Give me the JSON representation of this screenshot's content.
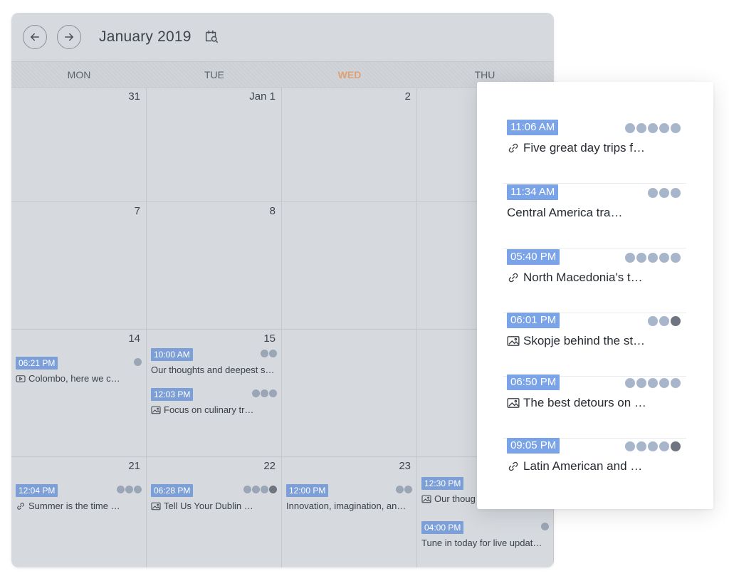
{
  "calendar": {
    "month_title": "January 2019",
    "weekdays": [
      "MON",
      "TUE",
      "WED",
      "THU"
    ],
    "today_weekday": "WED",
    "cells": [
      {
        "id": "r1c1",
        "day": "31",
        "events": []
      },
      {
        "id": "r1c2",
        "day": "Jan 1",
        "events": []
      },
      {
        "id": "r1c3",
        "day": "2",
        "events": []
      },
      {
        "id": "r2c1",
        "day": "7",
        "events": []
      },
      {
        "id": "r2c2",
        "day": "8",
        "events": []
      },
      {
        "id": "r3c1",
        "day": "14",
        "events": [
          {
            "time": "06:21 PM",
            "title": "Colombo, here we c…",
            "type": "video",
            "networks": [
              "twitter"
            ]
          }
        ]
      },
      {
        "id": "r3c2",
        "day": "15",
        "events": [
          {
            "time": "10:00 AM",
            "title": "Our thoughts and deepest s…",
            "type": "text",
            "networks": [
              "facebook",
              "twitter"
            ]
          },
          {
            "time": "12:03 PM",
            "title": "Focus on culinary tr…",
            "type": "image",
            "networks": [
              "facebook",
              "twitter",
              "linkedin"
            ]
          }
        ]
      },
      {
        "id": "r4c1",
        "day": "21",
        "events": [
          {
            "time": "12:04 PM",
            "title": "Summer is the time …",
            "type": "link",
            "networks": [
              "facebook",
              "twitter",
              "linkedin"
            ]
          }
        ]
      },
      {
        "id": "r4c2",
        "day": "22",
        "events": [
          {
            "time": "06:28 PM",
            "title": "Tell Us Your Dublin …",
            "type": "image",
            "networks": [
              "facebook",
              "twitter",
              "linkedin",
              "instagram"
            ]
          }
        ]
      },
      {
        "id": "r4c3",
        "day": "23",
        "events": [
          {
            "time": "12:00 PM",
            "title": "Innovation, imagination, an…",
            "type": "text",
            "networks": [
              "facebook",
              "twitter"
            ]
          }
        ]
      },
      {
        "id": "r4c4",
        "day": "",
        "events": [
          {
            "time": "12:30 PM",
            "title": "Our thoug",
            "type": "image",
            "networks": []
          },
          {
            "time": "04:00 PM",
            "title": "Tune in today for live updat…",
            "type": "text",
            "networks": [
              "facebook"
            ]
          }
        ]
      }
    ]
  },
  "popover": {
    "items": [
      {
        "time": "11:06 AM",
        "title": "Five great day trips f…",
        "type": "link",
        "networks": [
          "facebook",
          "twitter",
          "linkedin",
          "buffer",
          "google"
        ]
      },
      {
        "time": "11:34 AM",
        "title": "Central America tra…",
        "type": "text",
        "networks": [
          "facebook",
          "twitter",
          "linkedin"
        ]
      },
      {
        "time": "05:40 PM",
        "title": "North Macedonia's t…",
        "type": "link",
        "networks": [
          "facebook",
          "twitter",
          "linkedin",
          "buffer",
          "google"
        ]
      },
      {
        "time": "06:01 PM",
        "title": "Skopje behind the st…",
        "type": "image",
        "networks": [
          "facebook",
          "twitter",
          "instagram"
        ]
      },
      {
        "time": "06:50 PM",
        "title": "The best detours on …",
        "type": "image",
        "networks": [
          "facebook",
          "twitter",
          "linkedin",
          "buffer",
          "google"
        ]
      },
      {
        "time": "09:05 PM",
        "title": "Latin American and …",
        "type": "link",
        "networks": [
          "facebook",
          "twitter",
          "linkedin",
          "buffer",
          "instagram"
        ]
      }
    ]
  },
  "colors": {
    "time_badge": "#7b9fd6",
    "popover_time_badge": "#7ba4e8",
    "today_label": "#e0a073",
    "calendar_bg": "#d6dadf"
  }
}
